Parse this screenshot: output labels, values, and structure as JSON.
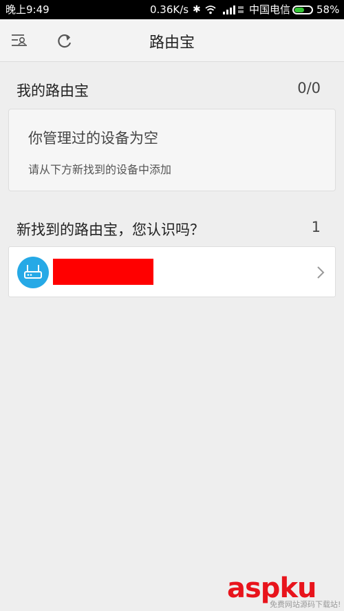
{
  "status_bar": {
    "time": "晚上9:49",
    "network_speed": "0.36K/s",
    "bluetooth_glyph": "✱",
    "carrier": "中国电信",
    "battery_percent": "58%",
    "battery_level": 0.58,
    "icons": [
      "bluetooth-icon",
      "wifi-icon",
      "signal-icon",
      "battery-icon"
    ]
  },
  "header": {
    "title": "路由宝",
    "left_icon": "menu-icon",
    "refresh_icon": "refresh-icon"
  },
  "my_routers": {
    "title": "我的路由宝",
    "count": "0/0",
    "empty_title": "你管理过的设备为空",
    "empty_hint": "请从下方新找到的设备中添加"
  },
  "found_routers": {
    "title": "新找到的路由宝，您认识吗？",
    "count": "1",
    "items": [
      {
        "icon": "router-icon",
        "name_redacted": true,
        "redaction_color": "#ff0000"
      }
    ]
  },
  "watermark": {
    "logo_red": "asp",
    "logo_light": "ku",
    "text": "免费网站源码下载站!"
  },
  "colors": {
    "accent_blue": "#26a9e6",
    "background": "#eeeeee",
    "battery_green": "#35c635"
  }
}
